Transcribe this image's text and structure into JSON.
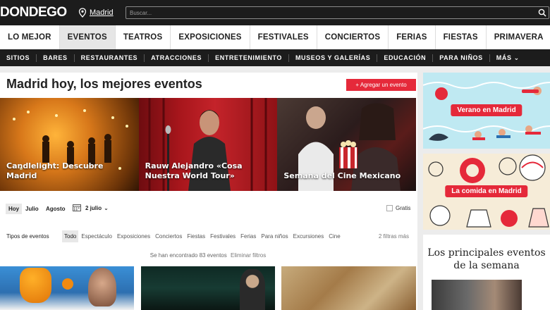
{
  "header": {
    "logo": "DONDEGO",
    "location": "Madrid",
    "search_placeholder": "Buscar..."
  },
  "main_nav": [
    "LO MEJOR",
    "EVENTOS",
    "TEATROS",
    "EXPOSICIONES",
    "FESTIVALES",
    "CONCIERTOS",
    "FERIAS",
    "FIESTAS",
    "PRIMAVERA"
  ],
  "main_nav_active": "EVENTOS",
  "sub_nav": [
    "SITIOS",
    "BARES",
    "RESTAURANTES",
    "ATRACCIONES",
    "ENTRETENIMIENTO",
    "MUSEOS Y GALERÍAS",
    "EDUCACIÓN",
    "PARA NIÑOS",
    "MÁS ⌄"
  ],
  "content": {
    "headline": "Madrid hoy, los mejores eventos",
    "add_event": "+ Agregar un evento",
    "featured": [
      {
        "label": "Candlelight: Descubre Madrid"
      },
      {
        "label": "Rauw Alejandro «Cosa Nuestra World Tour»"
      },
      {
        "label": "Semana del Cine Mexicano"
      }
    ],
    "date_filters": [
      "Hoy",
      "Julio",
      "Agosto"
    ],
    "date_selected": "2 julio",
    "free_label": "Gratis",
    "types_title": "Tipos de eventos",
    "types": [
      "Todo",
      "Espectáculo",
      "Exposiciones",
      "Conciertos",
      "Fiestas",
      "Festivales",
      "Ferias",
      "Para niños",
      "Excursiones",
      "Cine"
    ],
    "more_filters": "2 filtras más",
    "results_text": "Se han encontrado 83 eventos",
    "clear_filters": "Eliminar filtros"
  },
  "sidebar": {
    "promo1": "Verano en Madrid",
    "promo2": "La comida en Madrid",
    "highlights_title": "Los principales eventos de la semana"
  },
  "colors": {
    "accent": "#e5293a",
    "dark_bar": "#1c1c1c"
  }
}
